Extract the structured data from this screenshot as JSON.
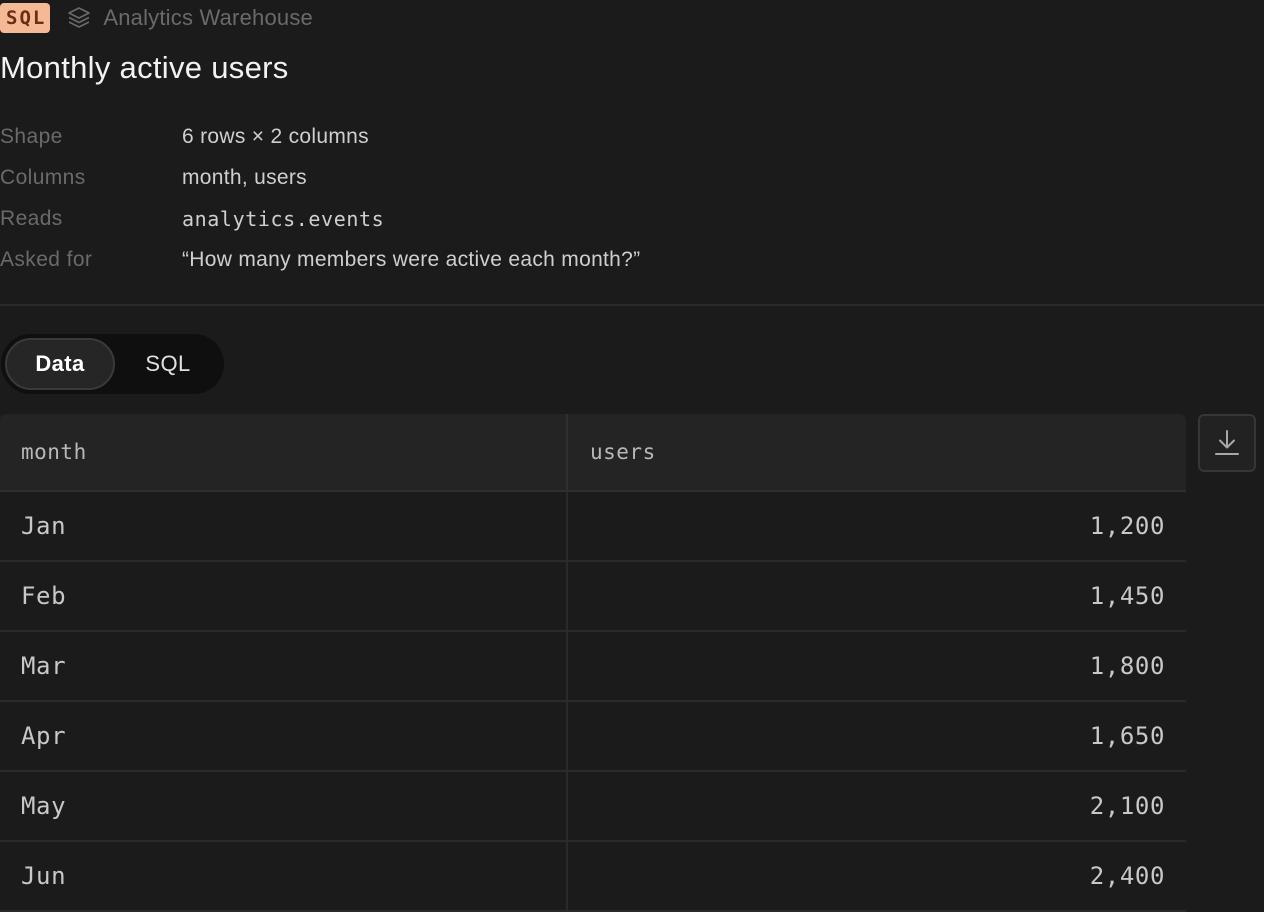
{
  "header": {
    "badge": "SQL",
    "source_icon": "layers-icon",
    "source_name": "Analytics Warehouse",
    "title": "Monthly active users"
  },
  "meta": {
    "shape_label": "Shape",
    "shape_value": "6 rows × 2 columns",
    "columns_label": "Columns",
    "columns_value": "month, users",
    "reads_label": "Reads",
    "reads_value": "analytics.events",
    "asked_label": "Asked for",
    "asked_value": "“How many members were active each month?”"
  },
  "tabs": [
    {
      "label": "Data",
      "active": true
    },
    {
      "label": "SQL",
      "active": false
    }
  ],
  "table": {
    "columns": [
      "month",
      "users"
    ],
    "rows": [
      [
        "Jan",
        "1,200"
      ],
      [
        "Feb",
        "1,450"
      ],
      [
        "Mar",
        "1,800"
      ],
      [
        "Apr",
        "1,650"
      ],
      [
        "May",
        "2,100"
      ],
      [
        "Jun",
        "2,400"
      ]
    ]
  },
  "download_icon": "download-icon",
  "colors": {
    "badge_bg": "#f6b995",
    "badge_text": "#6b2e14",
    "background": "#1b1b1b"
  }
}
